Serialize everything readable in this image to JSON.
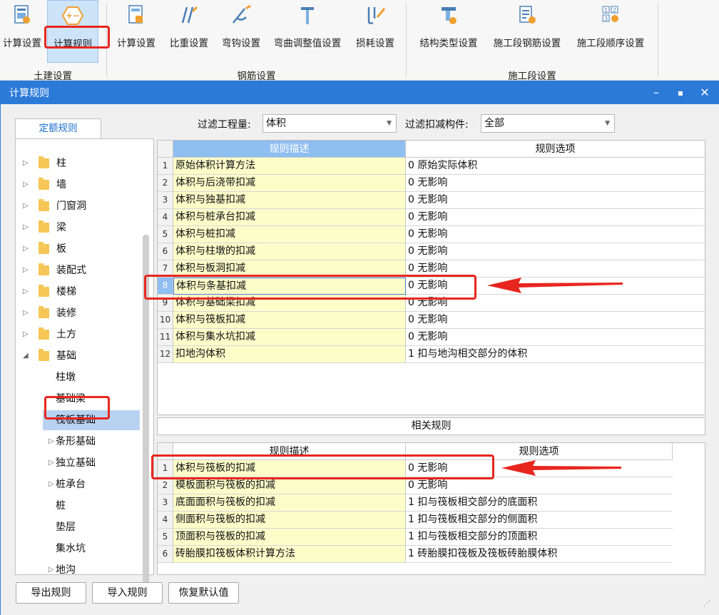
{
  "ribbon": {
    "buttons": [
      {
        "label": "计算设置",
        "icon": "settings-doc-icon"
      },
      {
        "label": "计算规则",
        "icon": "plus-minus-hex-icon"
      },
      {
        "label": "计算设置",
        "icon": "calc-settings-icon"
      },
      {
        "label": "比重设置",
        "icon": "rebar-weight-icon"
      },
      {
        "label": "弯钩设置",
        "icon": "hook-icon"
      },
      {
        "label": "弯曲调整值设置",
        "icon": "bend-adjust-icon"
      },
      {
        "label": "损耗设置",
        "icon": "loss-icon"
      },
      {
        "label": "结构类型设置",
        "icon": "structure-type-icon"
      },
      {
        "label": "施工段钢筋设置",
        "icon": "segment-rebar-icon"
      },
      {
        "label": "施工段顺序设置",
        "icon": "segment-order-icon"
      }
    ],
    "groups": [
      "土建设置",
      "钢筋设置",
      "施工段设置"
    ]
  },
  "dialog": {
    "title": "计算规则",
    "tab": "定额规则",
    "filter_qty_label": "过滤工程量:",
    "filter_qty_value": "体积",
    "filter_member_label": "过滤扣减构件:",
    "filter_member_value": "全部",
    "tree": [
      {
        "label": "柱",
        "level": 0,
        "folder": true,
        "arrow": "▷"
      },
      {
        "label": "墙",
        "level": 0,
        "folder": true,
        "arrow": "▷"
      },
      {
        "label": "门窗洞",
        "level": 0,
        "folder": true,
        "arrow": "▷"
      },
      {
        "label": "梁",
        "level": 0,
        "folder": true,
        "arrow": "▷"
      },
      {
        "label": "板",
        "level": 0,
        "folder": true,
        "arrow": "▷"
      },
      {
        "label": "装配式",
        "level": 0,
        "folder": true,
        "arrow": "▷"
      },
      {
        "label": "楼梯",
        "level": 0,
        "folder": true,
        "arrow": "▷"
      },
      {
        "label": "装修",
        "level": 0,
        "folder": true,
        "arrow": "▷"
      },
      {
        "label": "土方",
        "level": 0,
        "folder": true,
        "arrow": "▷"
      },
      {
        "label": "基础",
        "level": 0,
        "folder": true,
        "arrow": "◢"
      },
      {
        "label": "柱墩",
        "level": 1,
        "folder": false,
        "arrow": ""
      },
      {
        "label": "基础梁",
        "level": 1,
        "folder": false,
        "arrow": ""
      },
      {
        "label": "筏板基础",
        "level": 1,
        "folder": false,
        "arrow": "",
        "selected": true
      },
      {
        "label": "条形基础",
        "level": 1,
        "folder": false,
        "arrow": "▷"
      },
      {
        "label": "独立基础",
        "level": 1,
        "folder": false,
        "arrow": "▷"
      },
      {
        "label": "桩承台",
        "level": 1,
        "folder": false,
        "arrow": "▷"
      },
      {
        "label": "桩",
        "level": 1,
        "folder": false,
        "arrow": ""
      },
      {
        "label": "垫层",
        "level": 1,
        "folder": false,
        "arrow": ""
      },
      {
        "label": "集水坑",
        "level": 1,
        "folder": false,
        "arrow": ""
      },
      {
        "label": "地沟",
        "level": 1,
        "folder": false,
        "arrow": "▷"
      }
    ],
    "grid1": {
      "col_desc": "规则描述",
      "col_opt": "规则选项",
      "rows": [
        {
          "n": "1",
          "desc": "原始体积计算方法",
          "opt": "0 原始实际体积"
        },
        {
          "n": "2",
          "desc": "体积与后浇带扣减",
          "opt": "0  无影响"
        },
        {
          "n": "3",
          "desc": "体积与独基扣减",
          "opt": "0  无影响"
        },
        {
          "n": "4",
          "desc": "体积与桩承台扣减",
          "opt": "0  无影响"
        },
        {
          "n": "5",
          "desc": "体积与桩扣减",
          "opt": "0  无影响"
        },
        {
          "n": "6",
          "desc": "体积与柱墩的扣减",
          "opt": "0  无影响"
        },
        {
          "n": "7",
          "desc": "体积与板洞扣减",
          "opt": "0  无影响"
        },
        {
          "n": "8",
          "desc": "体积与条基扣减",
          "opt": "0  无影响"
        },
        {
          "n": "9",
          "desc": "体积与基础梁扣减",
          "opt": "0  无影响"
        },
        {
          "n": "10",
          "desc": "体积与筏板扣减",
          "opt": "0  无影响"
        },
        {
          "n": "11",
          "desc": "体积与集水坑扣减",
          "opt": "0  无影响"
        },
        {
          "n": "12",
          "desc": "扣地沟体积",
          "opt": "1  扣与地沟相交部分的体积"
        }
      ]
    },
    "related_title": "相关规则",
    "grid2": {
      "col_desc": "规则描述",
      "col_opt": "规则选项",
      "rows": [
        {
          "n": "1",
          "desc": "体积与筏板的扣减",
          "opt": "0  无影响"
        },
        {
          "n": "2",
          "desc": "模板面积与筏板的扣减",
          "opt": "0  无影响"
        },
        {
          "n": "3",
          "desc": "底面面积与筏板的扣减",
          "opt": "1  扣与筏板相交部分的底面积"
        },
        {
          "n": "4",
          "desc": "侧面积与筏板的扣减",
          "opt": "1  扣与筏板相交部分的侧面积"
        },
        {
          "n": "5",
          "desc": "顶面积与筏板的扣减",
          "opt": "1  扣与筏板相交部分的顶面积"
        },
        {
          "n": "6",
          "desc": "砖胎膜扣筏板体积计算方法",
          "opt": "1  砖胎膜扣筏板及筏板砖胎膜体积"
        }
      ]
    },
    "buttons": {
      "export": "导出规则",
      "import": "导入规则",
      "reset": "恢复默认值"
    }
  },
  "colors": {
    "title_bar": "#2b7ad8",
    "highlight_red": "#e8261f",
    "desc_cell": "#fcfdc9",
    "selected_row": "#b9d2f1"
  }
}
